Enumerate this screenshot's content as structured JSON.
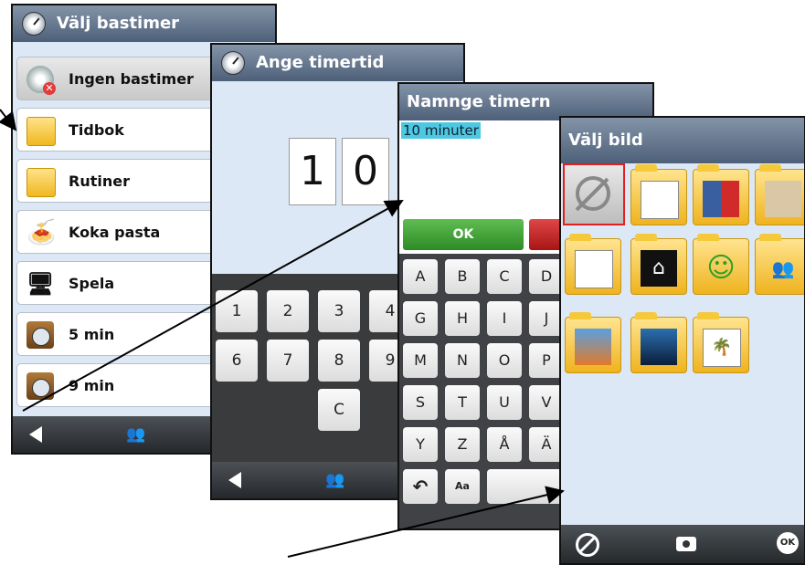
{
  "screen1": {
    "title": "Välj bastimer",
    "items": [
      {
        "label": "Ingen bastimer",
        "icon": "no-timer-icon"
      },
      {
        "label": "Tidbok",
        "icon": "folder-icon"
      },
      {
        "label": "Rutiner",
        "icon": "folder-icon"
      },
      {
        "label": "Koka pasta",
        "icon": "pasta-icon"
      },
      {
        "label": "Spela",
        "icon": "computer-game-icon"
      },
      {
        "label": "5 min",
        "icon": "timer-icon"
      },
      {
        "label": "9 min",
        "icon": "timer-icon"
      }
    ]
  },
  "screen2": {
    "title": "Ange timertid",
    "digits": [
      "1",
      "0"
    ],
    "keys": [
      "1",
      "2",
      "3",
      "4",
      "6",
      "7",
      "8",
      "9",
      "C"
    ]
  },
  "screen3": {
    "title": "Namnge timern",
    "value": "10 minuter",
    "ok_label": "OK",
    "keys": [
      "A",
      "B",
      "C",
      "D",
      "G",
      "H",
      "I",
      "J",
      "M",
      "N",
      "O",
      "P",
      "S",
      "T",
      "U",
      "V",
      "Y",
      "Z",
      "Å",
      "Ä"
    ],
    "shift_label": "Aa"
  },
  "screen4": {
    "title": "Välj bild",
    "tiles": [
      "no-image-icon",
      "food-person-folder-icon",
      "clothes-folder-icon",
      "furniture-folder-icon",
      "person-board-folder-icon",
      "house-folder-icon",
      "smiley-folder-icon",
      "people-folder-icon",
      "photo-camera-folder-icon",
      "dark-image-folder-icon",
      "palm-image-folder-icon"
    ]
  },
  "colors": {
    "title_bar": "#5d6e85",
    "ok_green": "#3a9a30",
    "cancel_red": "#c02020",
    "highlight": "#4ec8e2",
    "selected_border": "#e02020"
  }
}
